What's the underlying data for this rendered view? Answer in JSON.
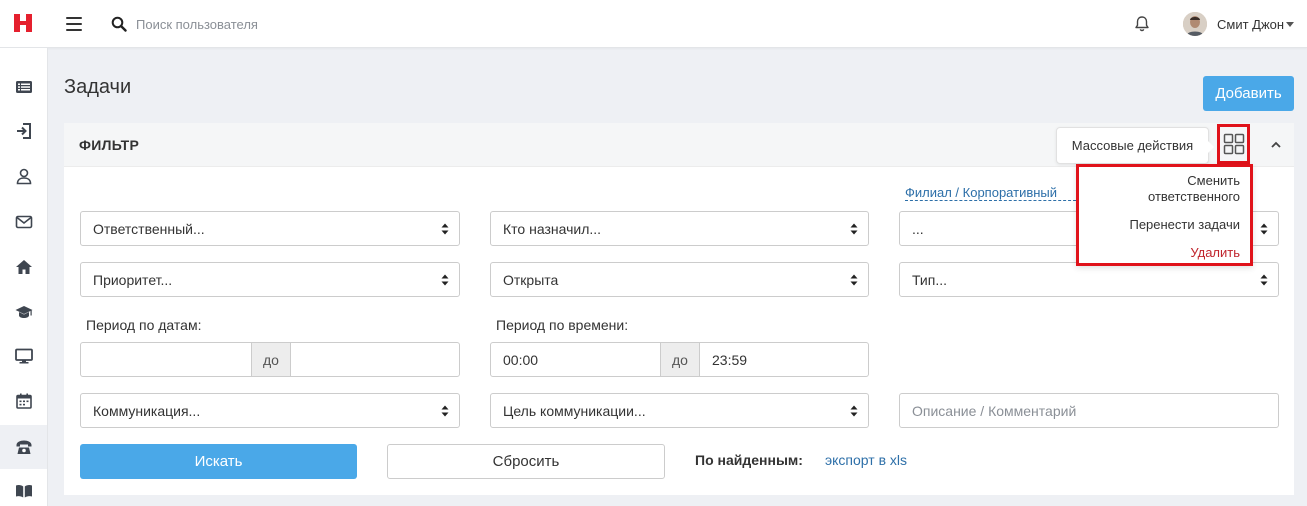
{
  "header": {
    "search_placeholder": "Поиск пользователя",
    "user_name": "Смит Джон"
  },
  "sidebar": {
    "items": [
      {
        "icon": "list-icon"
      },
      {
        "icon": "sign-in-icon"
      },
      {
        "icon": "user-icon"
      },
      {
        "icon": "envelope-icon"
      },
      {
        "icon": "home-icon"
      },
      {
        "icon": "graduation-cap-icon"
      },
      {
        "icon": "monitor-icon"
      },
      {
        "icon": "calendar-icon"
      },
      {
        "icon": "telephone-icon",
        "active": true
      },
      {
        "icon": "book-icon"
      }
    ]
  },
  "page": {
    "title": "Задачи",
    "add_label": "Добавить"
  },
  "filter": {
    "title": "ФИЛЬТР",
    "mass_actions_tooltip": "Массовые действия",
    "mass_actions_menu": {
      "change_responsible": "Сменить ответственного",
      "move_tasks": "Перенести задачи",
      "delete": "Удалить"
    },
    "branch_link": "Филиал / Корпоративный",
    "responsible": "Ответственный...",
    "assigned_by": "Кто назначил...",
    "third_select": "...",
    "priority": "Приоритет...",
    "status": "Открыта",
    "type": "Тип...",
    "date_period_label": "Период по датам:",
    "date_to": "до",
    "time_period_label": "Период по времени:",
    "time_from": "00:00",
    "time_to_addon": "до",
    "time_to": "23:59",
    "communication": "Коммуникация...",
    "communication_goal": "Цель коммуникации...",
    "description_placeholder": "Описание / Комментарий",
    "search_label": "Искать",
    "reset_label": "Сбросить",
    "found_label": "По найденным:",
    "export_label": "экспорт в xls"
  },
  "colors": {
    "primary": "#4aa8e8",
    "highlight": "#e0121a",
    "danger": "#c0242c",
    "link": "#2d6fa8",
    "logo": "#e5202e"
  }
}
